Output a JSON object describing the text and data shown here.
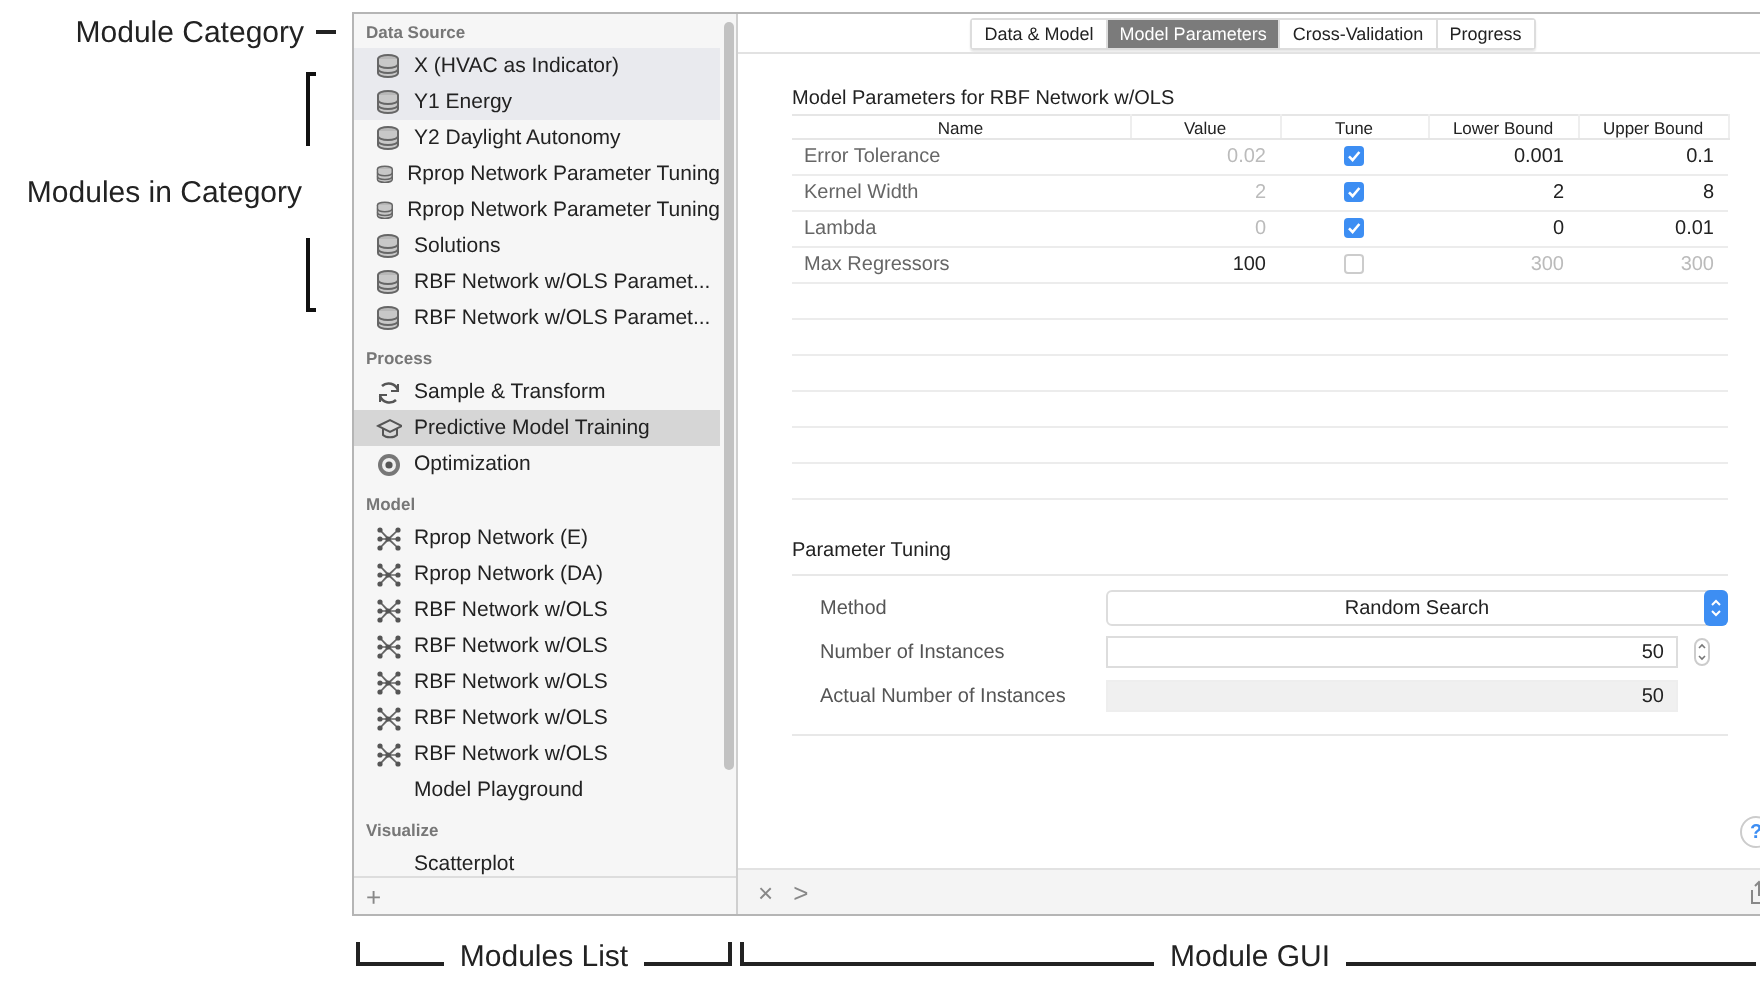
{
  "annotations": {
    "left": [
      {
        "kind": "dash",
        "text": "Module Category"
      },
      {
        "kind": "bracket",
        "text": "Modules in Category"
      }
    ],
    "bottom": [
      {
        "text": "Modules List"
      },
      {
        "text": "Module GUI"
      }
    ]
  },
  "sidebar": {
    "sections": [
      {
        "title": "Data Source",
        "items": [
          {
            "label": "X (HVAC as Indicator)",
            "kind": "database",
            "selected": false,
            "highlighted": true
          },
          {
            "label": "Y1 Energy",
            "kind": "database",
            "selected": false,
            "highlighted": true
          },
          {
            "label": "Y2 Daylight Autonomy",
            "kind": "database",
            "selected": false,
            "highlighted": false
          },
          {
            "label": "Rprop Network Parameter Tuning",
            "kind": "database",
            "selected": false,
            "highlighted": false
          },
          {
            "label": "Rprop Network Parameter Tuning",
            "kind": "database",
            "selected": false,
            "highlighted": false
          },
          {
            "label": "Solutions",
            "kind": "database",
            "selected": false,
            "highlighted": false
          },
          {
            "label": "RBF Network w/OLS Paramet...",
            "kind": "database",
            "selected": false,
            "highlighted": false
          },
          {
            "label": "RBF Network w/OLS Paramet...",
            "kind": "database",
            "selected": false,
            "highlighted": false
          }
        ]
      },
      {
        "title": "Process",
        "items": [
          {
            "label": "Sample & Transform",
            "kind": "cycle",
            "selected": false,
            "highlighted": false
          },
          {
            "label": "Predictive Model Training",
            "kind": "cap",
            "selected": true,
            "highlighted": false
          },
          {
            "label": "Optimization",
            "kind": "target",
            "selected": false,
            "highlighted": false
          }
        ]
      },
      {
        "title": "Model",
        "items": [
          {
            "label": "Rprop Network (E)",
            "kind": "network",
            "selected": false,
            "highlighted": false
          },
          {
            "label": "Rprop Network (DA)",
            "kind": "network",
            "selected": false,
            "highlighted": false
          },
          {
            "label": "RBF Network w/OLS",
            "kind": "network",
            "selected": false,
            "highlighted": false
          },
          {
            "label": "RBF Network w/OLS",
            "kind": "network",
            "selected": false,
            "highlighted": false
          },
          {
            "label": "RBF Network w/OLS",
            "kind": "network",
            "selected": false,
            "highlighted": false
          },
          {
            "label": "RBF Network w/OLS",
            "kind": "network",
            "selected": false,
            "highlighted": false
          },
          {
            "label": "RBF Network w/OLS",
            "kind": "network",
            "selected": false,
            "highlighted": false
          },
          {
            "label": "Model Playground",
            "kind": "none",
            "selected": false,
            "highlighted": false
          }
        ]
      },
      {
        "title": "Visualize",
        "items": [
          {
            "label": "Scatterplot",
            "kind": "none",
            "selected": false,
            "highlighted": false
          }
        ]
      }
    ],
    "add_button": "+"
  },
  "panel": {
    "tabs": [
      {
        "label": "Data & Model",
        "selected": false
      },
      {
        "label": "Model Parameters",
        "selected": true
      },
      {
        "label": "Cross-Validation",
        "selected": false
      },
      {
        "label": "Progress",
        "selected": false
      }
    ],
    "parameters": {
      "title": "Model Parameters for RBF Network w/OLS",
      "columns": [
        "Name",
        "Value",
        "Tune",
        "Lower Bound",
        "Upper Bound"
      ],
      "rows": [
        {
          "name": "Error Tolerance",
          "value": "0.02",
          "tune": true,
          "lower": "0.001",
          "upper": "0.1"
        },
        {
          "name": "Kernel Width",
          "value": "2",
          "tune": true,
          "lower": "2",
          "upper": "8"
        },
        {
          "name": "Lambda",
          "value": "0",
          "tune": true,
          "lower": "0",
          "upper": "0.01"
        },
        {
          "name": "Max Regressors",
          "value": "100",
          "tune": false,
          "lower": "300",
          "upper": "300"
        }
      ]
    },
    "tuning": {
      "title": "Parameter Tuning",
      "fields": [
        {
          "kind": "select",
          "label": "Method",
          "value": "Random Search"
        },
        {
          "kind": "stepper",
          "label": "Number of Instances",
          "value": "50"
        },
        {
          "kind": "readonly",
          "label": "Actual Number of Instances",
          "value": "50"
        }
      ]
    },
    "help": "?",
    "bottom_bar": {
      "close": "×",
      "forward": ">"
    }
  }
}
